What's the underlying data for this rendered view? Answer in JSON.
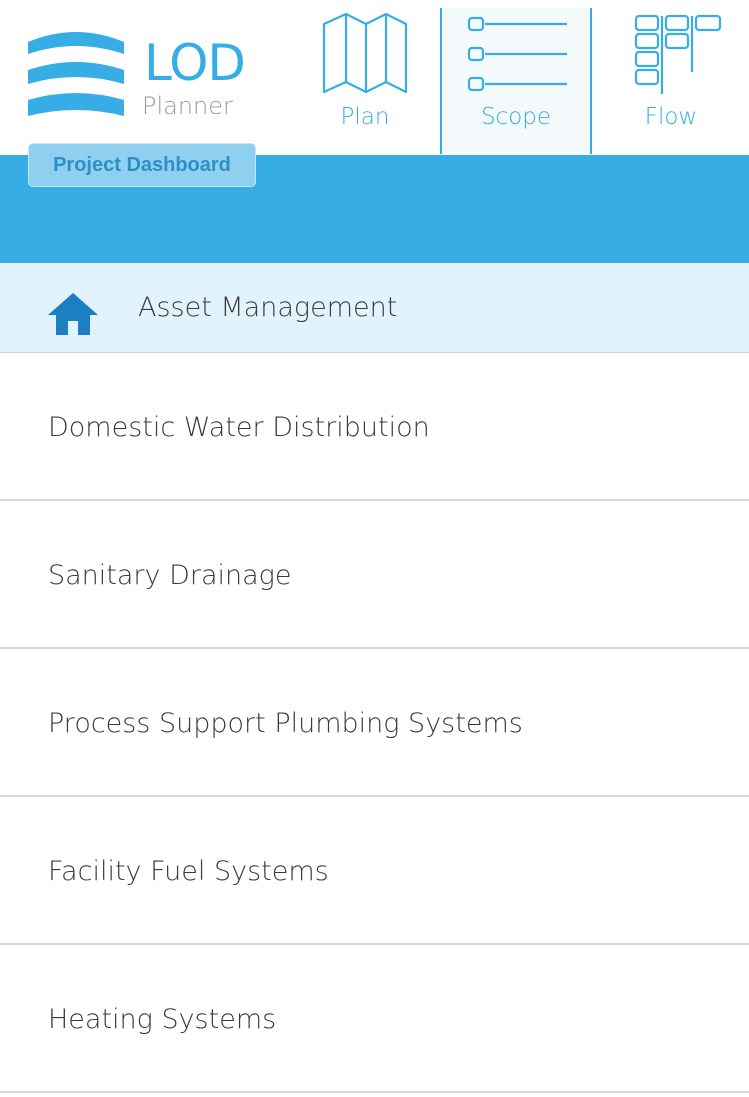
{
  "logo": {
    "title": "LOD",
    "subtitle": "Planner"
  },
  "nav": {
    "tabs": [
      {
        "label": "Plan",
        "icon": "map-icon",
        "active": false
      },
      {
        "label": "Scope",
        "icon": "list-icon",
        "active": true
      },
      {
        "label": "Flow",
        "icon": "kanban-icon",
        "active": false
      }
    ]
  },
  "toolbar": {
    "dashboard_label": "Project Dashboard"
  },
  "breadcrumb": {
    "icon": "home-icon",
    "label": "Asset Management"
  },
  "list": {
    "items": [
      {
        "label": "Domestic Water Distribution"
      },
      {
        "label": "Sanitary Drainage"
      },
      {
        "label": "Process Support Plumbing Systems"
      },
      {
        "label": "Facility Fuel Systems"
      },
      {
        "label": "Heating Systems"
      }
    ]
  },
  "colors": {
    "accent": "#36ade4",
    "breadcrumb_bg": "#e1f3fc",
    "divider": "#d8d8d8"
  }
}
